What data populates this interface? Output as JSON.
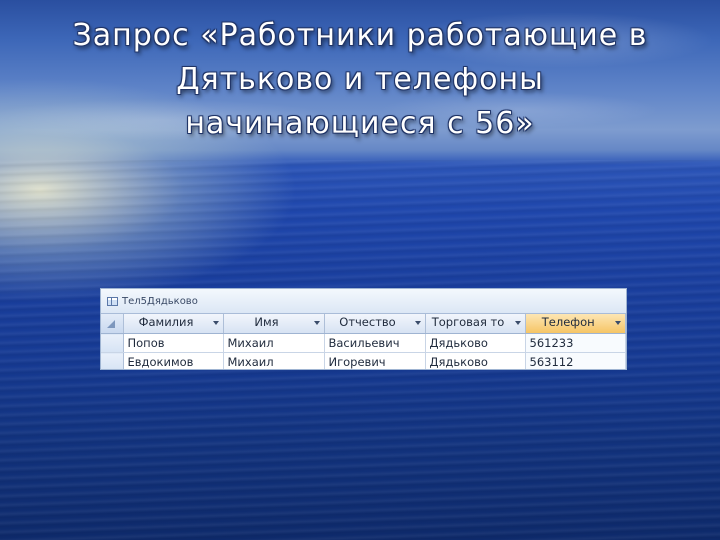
{
  "slide": {
    "title_lines": [
      "Запрос «Работники работающие в",
      "Дятьково и телефоны",
      "начинающиеся с 56»"
    ]
  },
  "datasheet": {
    "tab_label": "Тел5Дядьково",
    "columns": [
      "Фамилия",
      "Имя",
      "Отчество",
      "Торговая то",
      "Телефон"
    ],
    "rows": [
      [
        "Попов",
        "Михаил",
        "Васильевич",
        "Дядьково",
        "561233"
      ],
      [
        "Евдокимов",
        "Михаил",
        "Игоревич",
        "Дядьково",
        "563112"
      ]
    ],
    "highlighted_column": "Телефон",
    "colors": {
      "header_highlight": "#f6c566",
      "header": "#d7e3f3",
      "grid_border": "#9fb4d2"
    }
  }
}
